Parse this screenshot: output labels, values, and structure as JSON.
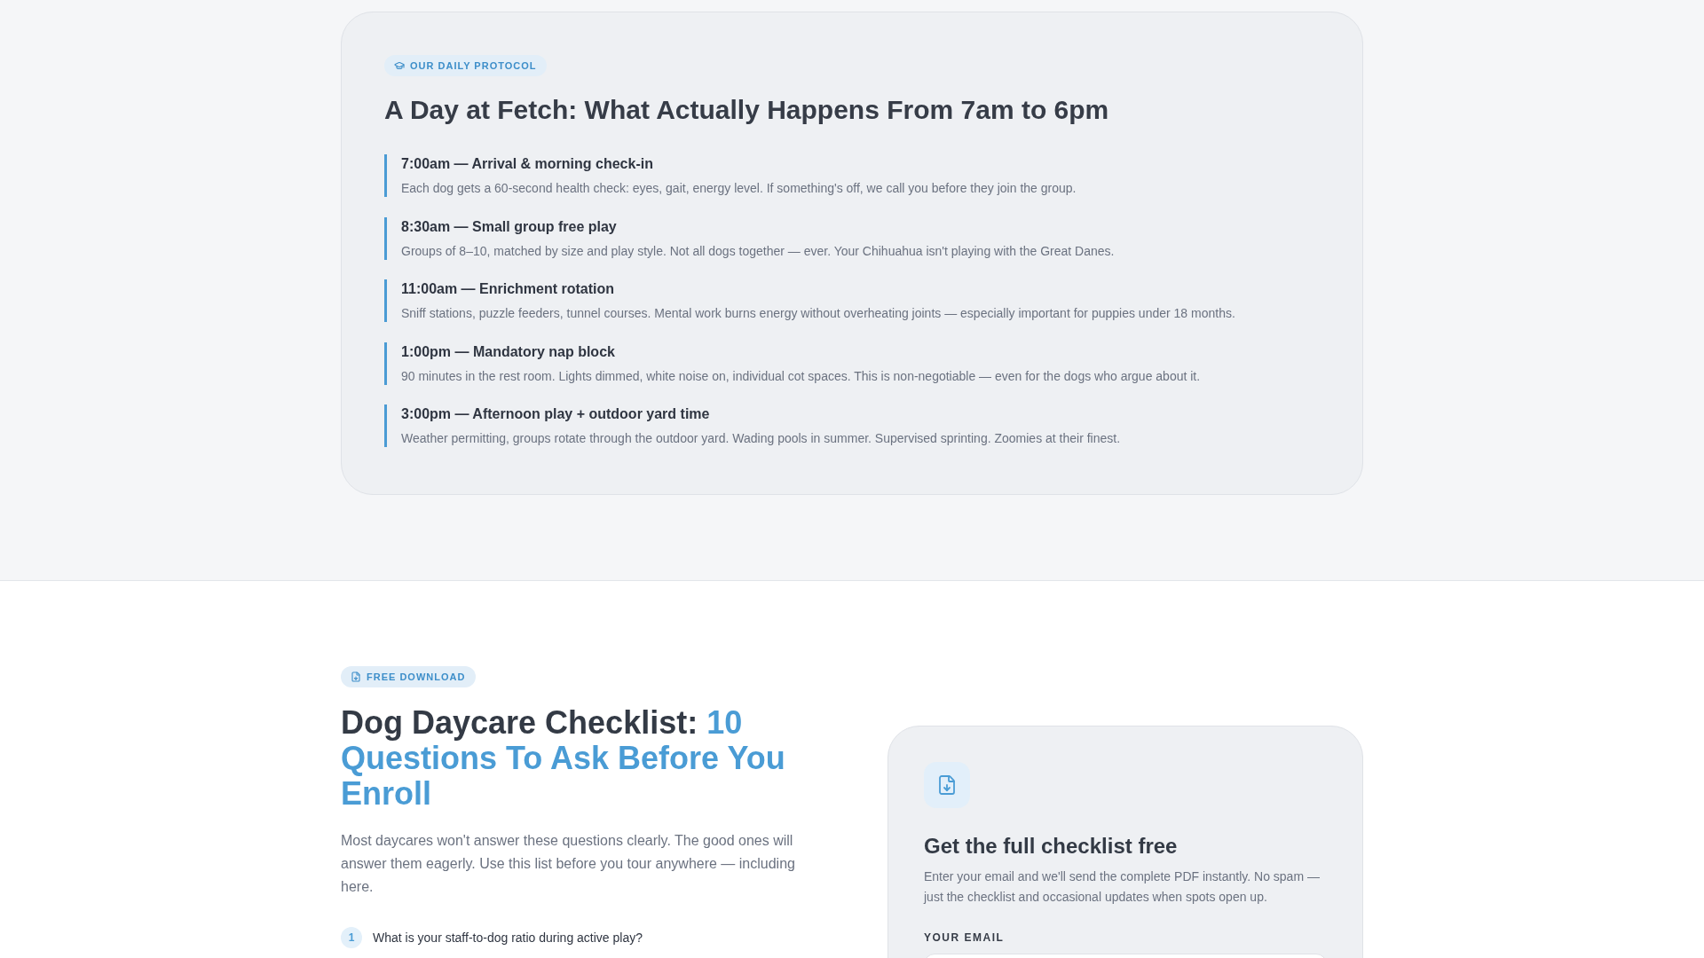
{
  "protocol": {
    "badge": {
      "label": "OUR DAILY PROTOCOL"
    },
    "title": "A Day at Fetch: What Actually Happens From 7am to 6pm",
    "schedule": [
      {
        "heading": "7:00am — Arrival & morning check-in",
        "description": "Each dog gets a 60-second health check: eyes, gait, energy level. If something's off, we call you before they join the group."
      },
      {
        "heading": "8:30am — Small group free play",
        "description": "Groups of 8–10, matched by size and play style. Not all dogs together — ever. Your Chihuahua isn't playing with the Great Danes."
      },
      {
        "heading": "11:00am — Enrichment rotation",
        "description": "Sniff stations, puzzle feeders, tunnel courses. Mental work burns energy without overheating joints — especially important for puppies under 18 months."
      },
      {
        "heading": "1:00pm — Mandatory nap block",
        "description": "90 minutes in the rest room. Lights dimmed, white noise on, individual cot spaces. This is non-negotiable — even for the dogs who argue about it."
      },
      {
        "heading": "3:00pm — Afternoon play + outdoor yard time",
        "description": "Weather permitting, groups rotate through the outdoor yard. Wading pools in summer. Supervised sprinting. Zoomies at their finest."
      }
    ]
  },
  "checklist": {
    "badge": {
      "label": "FREE DOWNLOAD"
    },
    "title": {
      "lead": "Dog Daycare Checklist:",
      "highlight": "10 Questions To Ask Before You Enroll"
    },
    "intro": "Most daycares won't answer these questions clearly. The good ones will answer them eagerly. Use this list before you tour anywhere — including here.",
    "questions": [
      {
        "number": "1",
        "text": "What is your staff-to-dog ratio during active play?"
      }
    ]
  },
  "signup_card": {
    "title": "Get the full checklist free",
    "description": "Enter your email and we'll send the complete PDF instantly. No spam — just the checklist and occasional updates when spots open up.",
    "email_label": "YOUR EMAIL"
  }
}
